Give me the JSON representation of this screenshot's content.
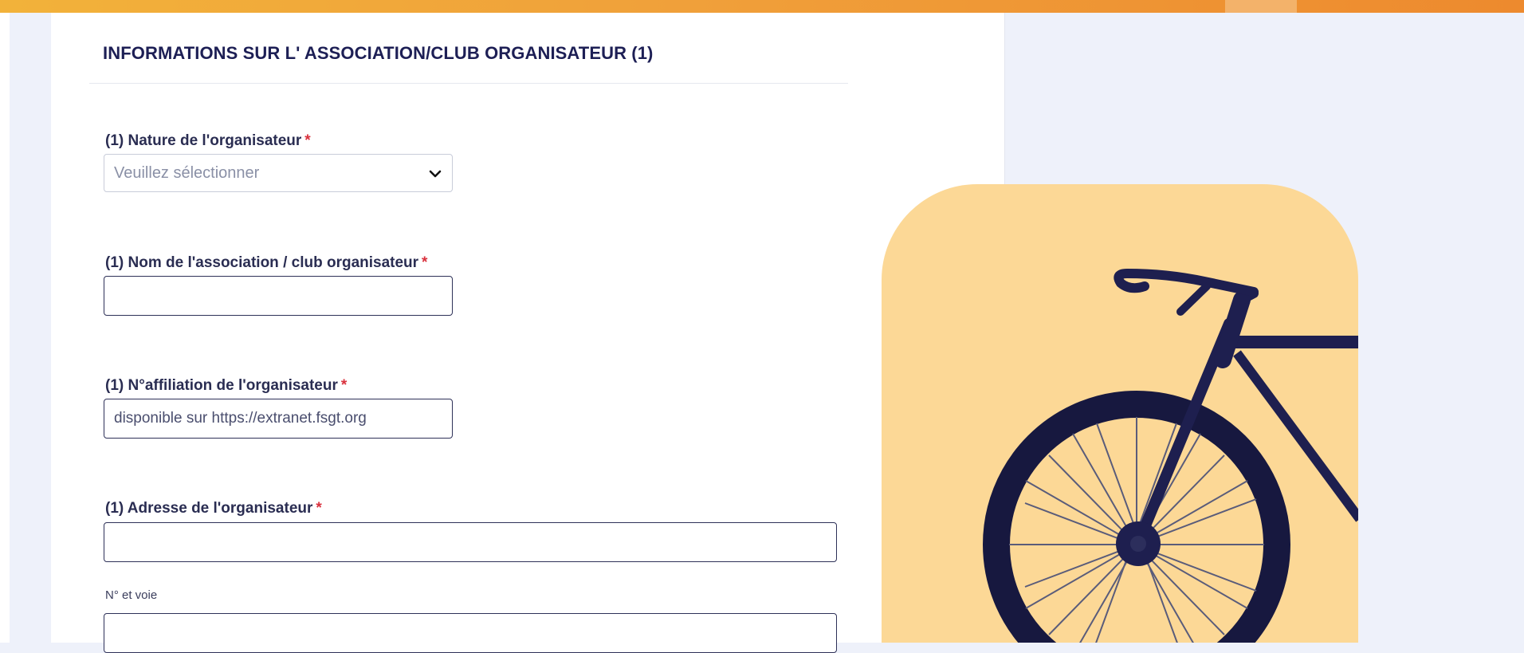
{
  "section": {
    "title": "INFORMATIONS SUR L' ASSOCIATION/CLUB ORGANISATEUR (1)"
  },
  "fields": {
    "nature": {
      "label": "(1) Nature de l'organisateur",
      "required_mark": "*",
      "placeholder": "Veuillez sélectionner"
    },
    "club_name": {
      "label": "(1) Nom de l'association / club organisateur",
      "required_mark": "*",
      "value": ""
    },
    "affiliation": {
      "label": "(1) N°affiliation de l'organisateur",
      "required_mark": "*",
      "placeholder": "disponible sur https://extranet.fsgt.org"
    },
    "address": {
      "label": "(1) Adresse de l'organisateur",
      "required_mark": "*",
      "value": "",
      "help": "N° et voie"
    },
    "address_line2": {
      "value": ""
    }
  },
  "colors": {
    "accent_orange": "#f0a03a",
    "required_red": "#d9313d",
    "navy": "#1d1f55",
    "illustration_bg": "#fcd896"
  },
  "icons": {
    "select_chevron": "chevron-down-icon",
    "illustration": "bicycle-icon"
  }
}
